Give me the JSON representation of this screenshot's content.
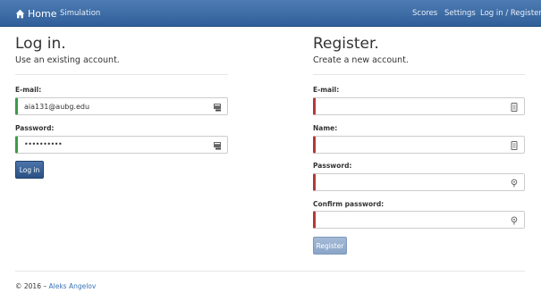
{
  "nav": {
    "brand_label": "Home",
    "simulation": "Simulation",
    "scores": "Scores",
    "settings": "Settings",
    "auth": "Log in / Register"
  },
  "login": {
    "title": "Log in.",
    "subtitle": "Use an existing account.",
    "email_label": "E-mail:",
    "email_value": "aia131@aubg.edu",
    "password_label": "Password:",
    "password_value": "••••••••••",
    "submit_label": "Log in"
  },
  "register": {
    "title": "Register.",
    "subtitle": "Create a new account.",
    "email_label": "E-mail:",
    "name_label": "Name:",
    "password_label": "Password:",
    "confirm_label": "Confirm password:",
    "submit_label": "Register"
  },
  "footer": {
    "prefix": "© 2016 –",
    "author": "Aleks Angelov"
  },
  "colors": {
    "navbar": "#3b6aa5",
    "valid": "#3a9b4a",
    "invalid": "#b23a3a",
    "link": "#3a73b5"
  }
}
